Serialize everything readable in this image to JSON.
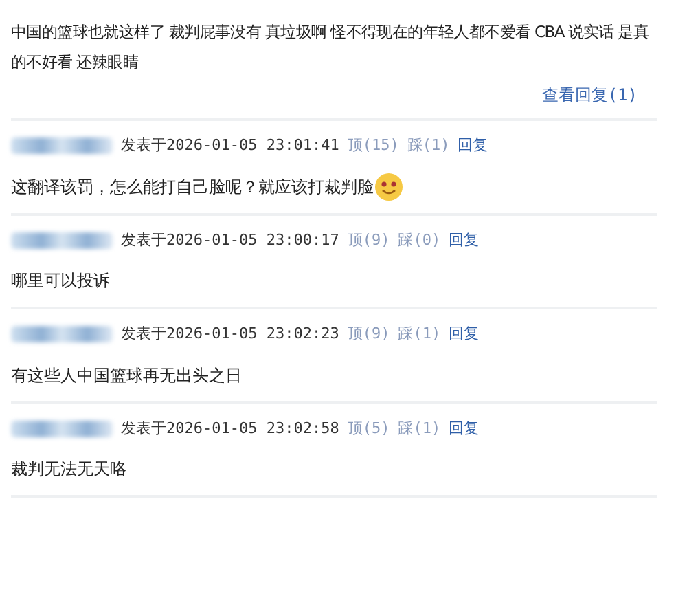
{
  "post": {
    "text": "中国的篮球也就这样了 裁判屁事没有 真垃圾啊 怪不得现在的年轻人都不爱看 CBA 说实话 是真的不好看 还辣眼睛",
    "view_replies": "查看回复(1)"
  },
  "comments": [
    {
      "posted": "发表于2026-01-05 23:01:41",
      "up": "顶(15)",
      "down": "踩(1)",
      "reply": "回复",
      "body": "这翻译该罚，怎么能打自己脸呢？就应该打裁判脸",
      "emoji": true
    },
    {
      "posted": "发表于2026-01-05 23:00:17",
      "up": "顶(9)",
      "down": "踩(0)",
      "reply": "回复",
      "body": "哪里可以投诉",
      "emoji": false
    },
    {
      "posted": "发表于2026-01-05 23:02:23",
      "up": "顶(9)",
      "down": "踩(1)",
      "reply": "回复",
      "body": "有这些人中国篮球再无出头之日",
      "emoji": false
    },
    {
      "posted": "发表于2026-01-05 23:02:58",
      "up": "顶(5)",
      "down": "踩(1)",
      "reply": "回复",
      "body": "裁判无法无天咯",
      "emoji": false
    }
  ]
}
